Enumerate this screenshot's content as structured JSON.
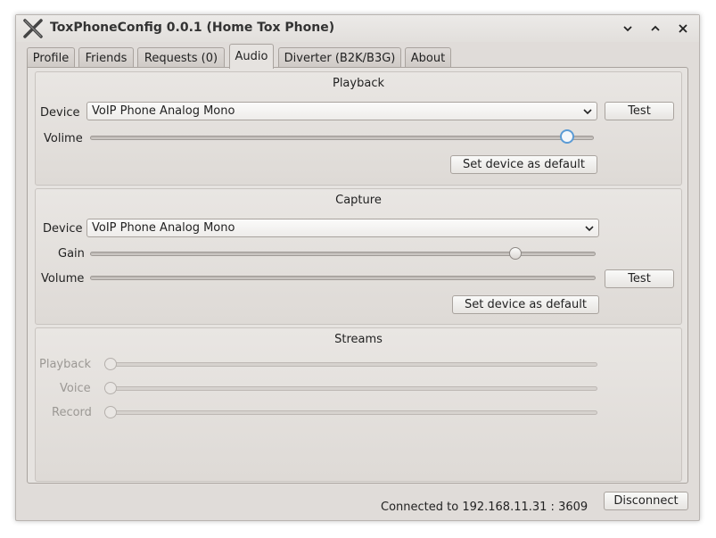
{
  "window": {
    "title": "ToxPhoneConfig 0.0.1 (Home Tox Phone)"
  },
  "tabs": [
    {
      "label": "Profile"
    },
    {
      "label": "Friends"
    },
    {
      "label": "Requests (0)"
    },
    {
      "label": "Audio"
    },
    {
      "label": "Diverter (B2K/B3G)"
    },
    {
      "label": "About"
    }
  ],
  "active_tab": "Audio",
  "playback": {
    "title": "Playback",
    "device_label": "Device",
    "device_value": "VoIP Phone Analog Mono",
    "test_label": "Test",
    "volume_label": "Volime",
    "volume_level": 0.96,
    "default_label": "Set device as default"
  },
  "capture": {
    "title": "Capture",
    "device_label": "Device",
    "device_value": "VoIP Phone Analog Mono",
    "gain_label": "Gain",
    "gain_level": 0.85,
    "volume_label": "Volume",
    "volume_level": 0.0,
    "test_label": "Test",
    "default_label": "Set device as default"
  },
  "streams": {
    "title": "Streams",
    "playback_label": "Playback",
    "voice_label": "Voice",
    "record_label": "Record",
    "playback_level": 0.0,
    "voice_level": 0.0,
    "record_level": 0.0
  },
  "footer": {
    "status": "Connected to 192.168.11.31 : 3609",
    "disconnect_label": "Disconnect"
  },
  "colors": {
    "accent": "#5b9bd5",
    "window_bg": "#e0dcd9"
  }
}
